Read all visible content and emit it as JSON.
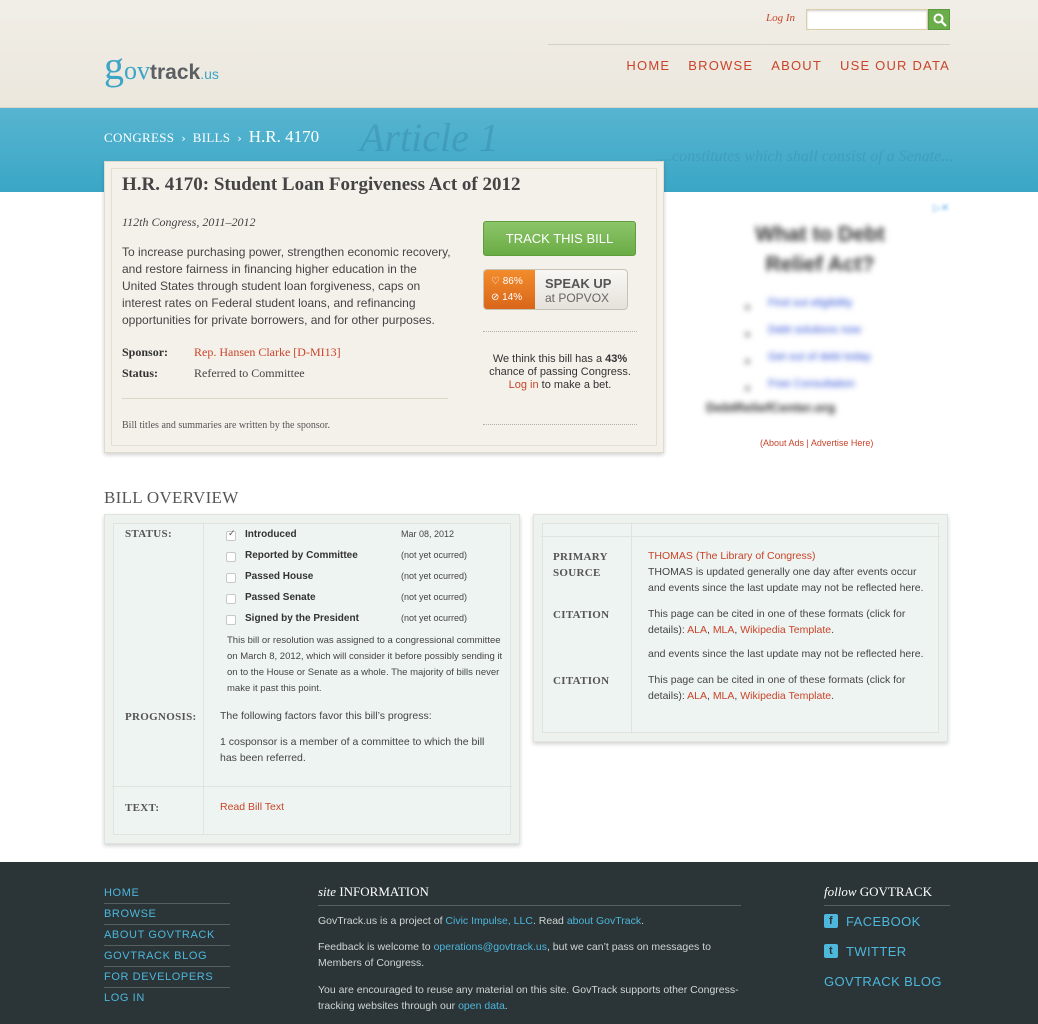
{
  "header": {
    "logo": {
      "g": "g",
      "ov": "ov",
      "track": "track",
      "us": ".us"
    },
    "login_label": "Log In",
    "search_placeholder": "",
    "nav": [
      "HOME",
      "BROWSE",
      "ABOUT",
      "USE OUR DATA"
    ]
  },
  "band": {
    "deco": "Article 1",
    "deco2": "...constitutes which shall consist of a Senate..."
  },
  "breadcrumb": {
    "items": [
      "CONGRESS",
      "BILLS"
    ],
    "separator": "›",
    "current": "H.R. 4170"
  },
  "bill": {
    "title": "H.R. 4170: Student Loan Forgiveness Act of 2012",
    "congress": "112th Congress, 2011–2012",
    "summary": "To increase purchasing power, strengthen economic recovery, and restore fairness in financing higher education in the United States through student loan forgiveness, caps on interest rates on Federal student loans, and refinancing opportunities for private borrowers, and for other purposes.",
    "sponsor_label": "Sponsor:",
    "sponsor_value": "Rep. Hansen Clarke [D-MI13]",
    "status_label": "Status:",
    "status_value": "Referred to Committee",
    "note": "Bill titles and summaries are written by the sponsor.",
    "track_button": "TRACK THIS BILL",
    "popvox": {
      "support": "86%",
      "oppose": "14%",
      "speak_up": "SPEAK UP",
      "at": "at POPVOX"
    },
    "prognosis": {
      "pre": "We think this bill has a",
      "percent": "43%",
      "post": "chance of passing Congress.",
      "login": "Log in",
      "after_login": "to make a bet."
    }
  },
  "ad": {
    "title": "What to Debt Relief Act?",
    "items": [
      "Find out eligibility",
      "Debt solutions now",
      "Get out of debt today",
      "Free Consultation"
    ],
    "footer": "DebtReliefCenter.org",
    "links": "(About Ads | Advertise Here)"
  },
  "overview": {
    "heading": "BILL OVERVIEW",
    "status_label": "STATUS:",
    "statuses": [
      {
        "name": "Introduced",
        "date": "Mar 08, 2012",
        "checked": true
      },
      {
        "name": "Reported by Committee",
        "date": "(not yet ocurred)",
        "checked": false
      },
      {
        "name": "Passed House",
        "date": "(not yet ocurred)",
        "checked": false
      },
      {
        "name": "Passed Senate",
        "date": "(not yet ocurred)",
        "checked": false
      },
      {
        "name": "Signed by the President",
        "date": "(not yet ocurred)",
        "checked": false
      }
    ],
    "status_desc": "This bill or resolution was assigned to a congressional committee on March 8, 2012, which will consider it before possibly sending it on to the House or Senate as a whole. The majority of bills never make it past this point.",
    "prognosis_label": "PROGNOSIS:",
    "prognosis_text": "The following factors favor this bill’s progress:",
    "prognosis_factor": "1 cosponsor is a member of a committee to which the bill has been referred.",
    "text_label": "TEXT:",
    "read_bill": "Read Bill Text",
    "primary_source_label": "PRIMARY SOURCE",
    "primary_source_link": "THOMAS (The Library of Congress)",
    "primary_source_text": "THOMAS is updated generally one day after events occur and events since the last update may not be reflected here.",
    "citation_label": "CITATION",
    "citation_pre": "This page can be cited in one of these formats (click for details):",
    "citation_ala": "ALA",
    "citation_mla": "MLA",
    "citation_wiki": "Wikipedia Template",
    "extra_line": "and events since the last update may not be reflected here."
  },
  "footer": {
    "nav": [
      "HOME",
      "BROWSE",
      "ABOUT GOVTRACK",
      "GOVTRACK BLOG",
      "FOR DEVELOPERS",
      "LOG IN"
    ],
    "site_heading_italic": "site",
    "site_heading": "INFORMATION",
    "p1_pre": "GovTrack.us is a project of",
    "p1_link1": "Civic Impulse, LLC",
    "p1_mid": ". Read",
    "p1_link2": "about GovTrack",
    "p2_pre": "Feedback is welcome to",
    "p2_link": "operations@govtrack.us",
    "p2_post": ", but we can’t pass on messages to Members of Congress.",
    "p3_pre": "You are encouraged to reuse any material on this site. GovTrack supports other Congress-tracking websites through our",
    "p3_link": "open data",
    "follow_italic": "follow",
    "follow_heading": "GOVTRACK",
    "social": [
      {
        "label": "FACEBOOK",
        "icon": "facebook-icon",
        "glyph": "f"
      },
      {
        "label": "TWITTER",
        "icon": "twitter-icon",
        "glyph": "t"
      }
    ],
    "blog": "GOVTRACK BLOG"
  }
}
